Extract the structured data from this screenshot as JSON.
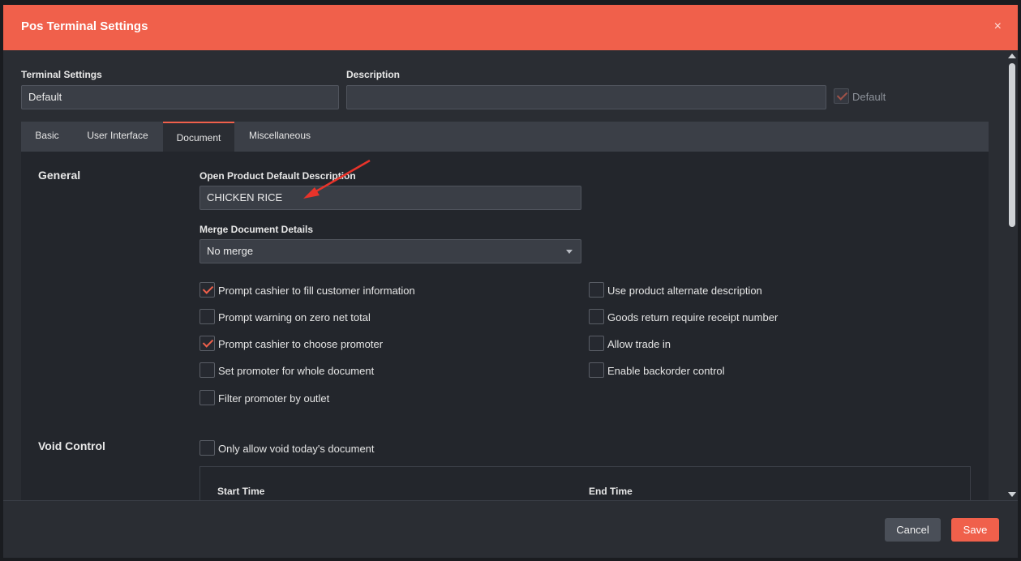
{
  "dialog": {
    "title": "Pos Terminal Settings",
    "close_symbol": "×"
  },
  "top_fields": {
    "terminal_settings_label": "Terminal Settings",
    "terminal_settings_value": "Default",
    "description_label": "Description",
    "description_value": "",
    "default_label": "Default",
    "default_checked": true
  },
  "tabs": [
    {
      "label": "Basic",
      "active": false
    },
    {
      "label": "User Interface",
      "active": false
    },
    {
      "label": "Document",
      "active": true
    },
    {
      "label": "Miscellaneous",
      "active": false
    }
  ],
  "general": {
    "section_title": "General",
    "open_product_label": "Open Product Default Description",
    "open_product_value": "CHICKEN RICE",
    "merge_label": "Merge Document Details",
    "merge_value": "No merge",
    "options_left": [
      {
        "label": "Prompt cashier to fill customer information",
        "checked": true
      },
      {
        "label": "Prompt warning on zero net total",
        "checked": false
      },
      {
        "label": "Prompt cashier to choose promoter",
        "checked": true
      },
      {
        "label": "Set promoter for whole document",
        "checked": false
      },
      {
        "label": "Filter promoter by outlet",
        "checked": false
      }
    ],
    "options_right": [
      {
        "label": "Use product alternate description",
        "checked": false
      },
      {
        "label": "Goods return require receipt number",
        "checked": false
      },
      {
        "label": "Allow trade in",
        "checked": false
      },
      {
        "label": "Enable backorder control",
        "checked": false
      }
    ]
  },
  "void_control": {
    "section_title": "Void Control",
    "only_today_label": "Only allow void today's document",
    "only_today_checked": false,
    "start_time_label": "Start Time",
    "end_time_label": "End Time"
  },
  "footer": {
    "cancel_label": "Cancel",
    "save_label": "Save"
  },
  "colors": {
    "accent": "#f0604b",
    "background": "#2a2d33"
  }
}
